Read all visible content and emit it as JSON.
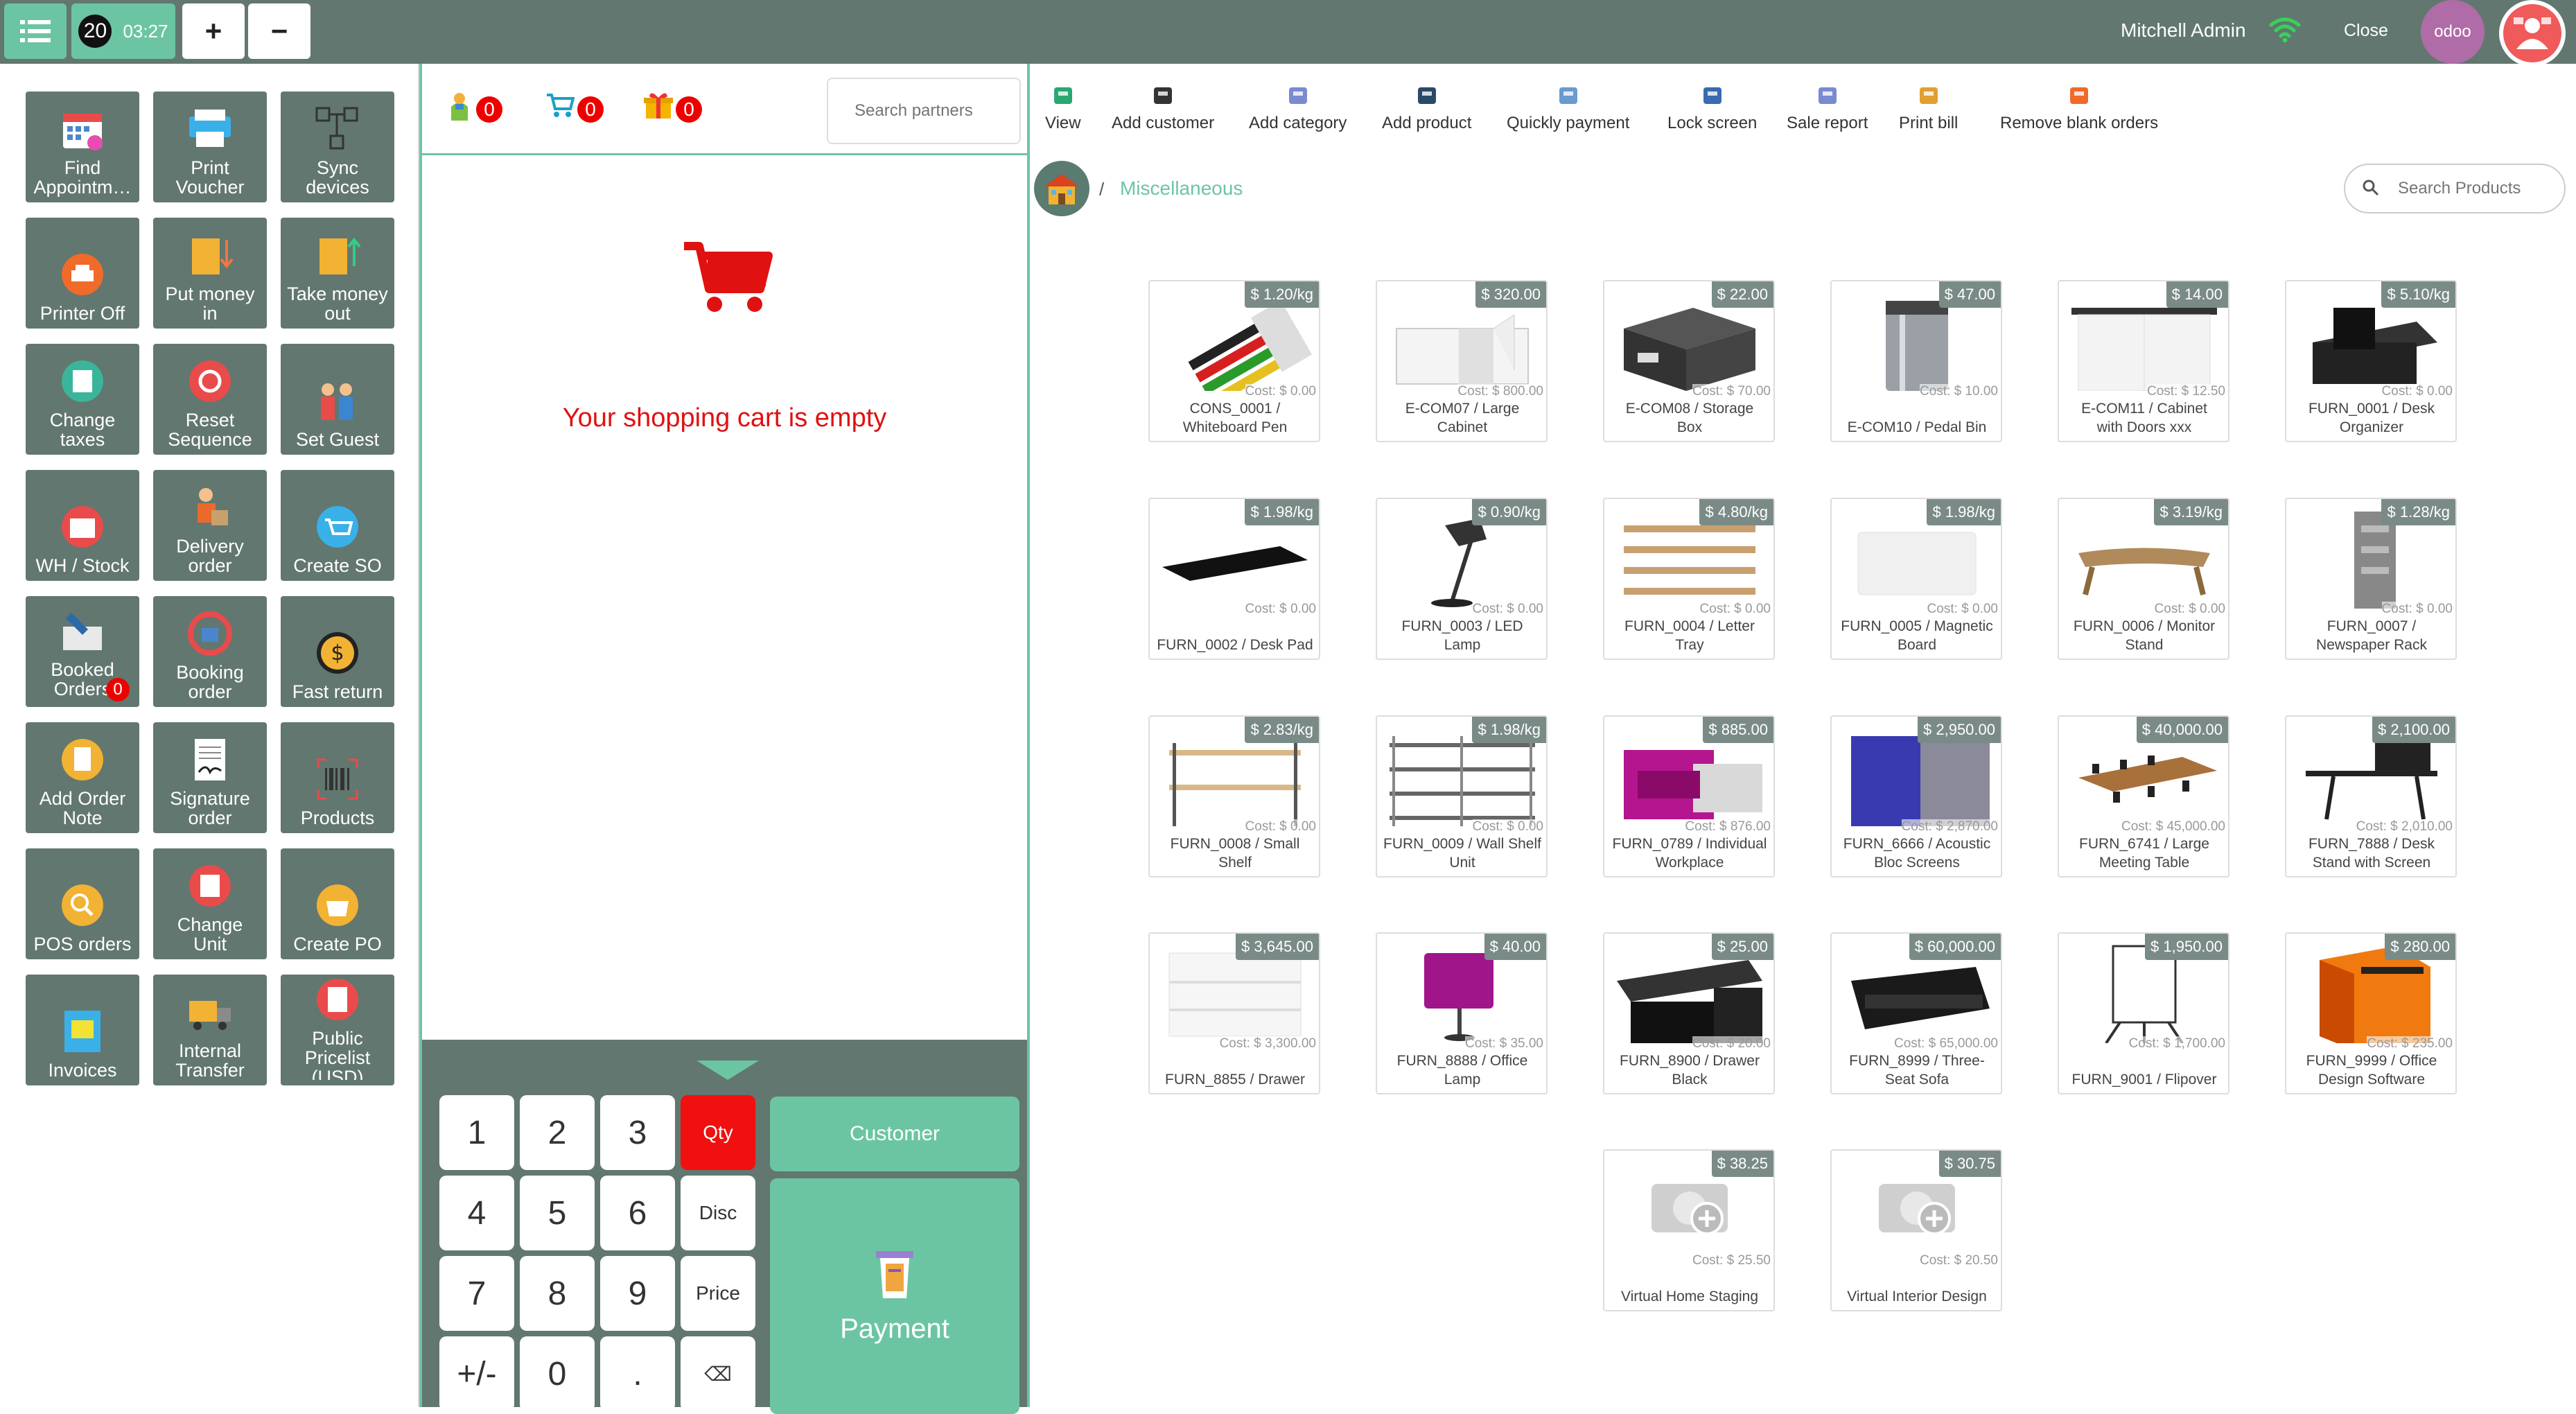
{
  "topbar": {
    "order_number": "20",
    "order_time": "03:27",
    "plus_label": "+",
    "minus_label": "−",
    "user_name": "Mitchell Admin",
    "close_label": "Close",
    "odoo_label": "odoo"
  },
  "tiles": [
    {
      "label": "Find\nAppointm…",
      "name": "find-appointment"
    },
    {
      "label": "Print\nVoucher",
      "name": "print-voucher"
    },
    {
      "label": "Sync\ndevices",
      "name": "sync-devices"
    },
    {
      "label": "Printer Off",
      "name": "printer-off"
    },
    {
      "label": "Put money\nin",
      "name": "put-money-in"
    },
    {
      "label": "Take money\nout",
      "name": "take-money-out"
    },
    {
      "label": "Change\ntaxes",
      "name": "change-taxes"
    },
    {
      "label": "Reset\nSequence",
      "name": "reset-sequence"
    },
    {
      "label": "Set Guest",
      "name": "set-guest"
    },
    {
      "label": "WH / Stock",
      "name": "wh-stock"
    },
    {
      "label": "Delivery\norder",
      "name": "delivery-order"
    },
    {
      "label": "Create SO",
      "name": "create-so"
    },
    {
      "label": "Booked\nOrders",
      "name": "booked-orders",
      "badge": "0"
    },
    {
      "label": "Booking\norder",
      "name": "booking-order"
    },
    {
      "label": "Fast return",
      "name": "fast-return"
    },
    {
      "label": "Add Order\nNote",
      "name": "add-order-note"
    },
    {
      "label": "Signature\norder",
      "name": "signature-order"
    },
    {
      "label": "Products",
      "name": "products"
    },
    {
      "label": "POS orders",
      "name": "pos-orders"
    },
    {
      "label": "Change\nUnit",
      "name": "change-unit"
    },
    {
      "label": "Create PO",
      "name": "create-po"
    },
    {
      "label": "Invoices",
      "name": "invoices"
    },
    {
      "label": "Internal\nTransfer",
      "name": "internal-transfer"
    },
    {
      "label": "Public\nPricelist\n(USD)",
      "name": "public-pricelist"
    }
  ],
  "order_header": {
    "client_count": "0",
    "cart_count": "0",
    "gift_count": "0",
    "search_placeholder": "Search partners"
  },
  "cart": {
    "empty_message": "Your shopping cart is empty"
  },
  "numpad": {
    "keys": [
      "1",
      "2",
      "3",
      "Qty",
      "4",
      "5",
      "6",
      "Disc",
      "7",
      "8",
      "9",
      "Price",
      "+/-",
      "0",
      ".",
      "⌫"
    ],
    "customer_label": "Customer",
    "payment_label": "Payment"
  },
  "toolbar": [
    {
      "label": "View",
      "icon": "view-icon"
    },
    {
      "label": "Add customer",
      "icon": "add-customer-icon"
    },
    {
      "label": "Add category",
      "icon": "add-category-icon"
    },
    {
      "label": "Add product",
      "icon": "add-product-icon"
    },
    {
      "label": "Quickly payment",
      "icon": "quick-payment-icon"
    },
    {
      "label": "Lock screen",
      "icon": "lock-screen-icon"
    },
    {
      "label": "Sale report",
      "icon": "sale-report-icon"
    },
    {
      "label": "Print bill",
      "icon": "print-bill-icon"
    },
    {
      "label": "Remove blank orders",
      "icon": "trash-icon"
    }
  ],
  "breadcrumb": {
    "separator": "/",
    "category": "Miscellaneous"
  },
  "search_products_placeholder": "Search Products",
  "products": [
    {
      "name": "CONS_0001 /\nWhiteboard Pen",
      "price": "$ 1.20/kg",
      "cost": "Cost: $ 0.00",
      "kind": "pens"
    },
    {
      "name": "E-COM07 / Large\nCabinet",
      "price": "$ 320.00",
      "cost": "Cost: $ 800.00",
      "kind": "cabinet"
    },
    {
      "name": "E-COM08 / Storage\nBox",
      "price": "$ 22.00",
      "cost": "Cost: $ 70.00",
      "kind": "box"
    },
    {
      "name": "E-COM10 / Pedal Bin",
      "price": "$ 47.00",
      "cost": "Cost: $ 10.00",
      "kind": "bin"
    },
    {
      "name": "E-COM11 / Cabinet\nwith Doors xxx",
      "price": "$ 14.00",
      "cost": "Cost: $ 12.50",
      "kind": "cabinet2"
    },
    {
      "name": "FURN_0001 / Desk\nOrganizer",
      "price": "$ 5.10/kg",
      "cost": "Cost: $ 0.00",
      "kind": "organizer"
    },
    {
      "name": "FURN_0002 / Desk Pad",
      "price": "$ 1.98/kg",
      "cost": "Cost: $ 0.00",
      "kind": "pad"
    },
    {
      "name": "FURN_0003 / LED\nLamp",
      "price": "$ 0.90/kg",
      "cost": "Cost: $ 0.00",
      "kind": "lamp"
    },
    {
      "name": "FURN_0004 / Letter\nTray",
      "price": "$ 4.80/kg",
      "cost": "Cost: $ 0.00",
      "kind": "tray"
    },
    {
      "name": "FURN_0005 / Magnetic\nBoard",
      "price": "$ 1.98/kg",
      "cost": "Cost: $ 0.00",
      "kind": "board"
    },
    {
      "name": "FURN_0006 / Monitor\nStand",
      "price": "$ 3.19/kg",
      "cost": "Cost: $ 0.00",
      "kind": "stand"
    },
    {
      "name": "FURN_0007 /\nNewspaper Rack",
      "price": "$ 1.28/kg",
      "cost": "Cost: $ 0.00",
      "kind": "rack"
    },
    {
      "name": "FURN_0008 / Small\nShelf",
      "price": "$ 2.83/kg",
      "cost": "Cost: $ 0.00",
      "kind": "shelf"
    },
    {
      "name": "FURN_0009 / Wall Shelf\nUnit",
      "price": "$ 1.98/kg",
      "cost": "Cost: $ 0.00",
      "kind": "wallshelf"
    },
    {
      "name": "FURN_0789 / Individual\nWorkplace",
      "price": "$ 885.00",
      "cost": "Cost: $ 876.00",
      "kind": "workplace"
    },
    {
      "name": "FURN_6666 / Acoustic\nBloc Screens",
      "price": "$ 2,950.00",
      "cost": "Cost: $ 2,870.00",
      "kind": "screens"
    },
    {
      "name": "FURN_6741 / Large\nMeeting Table",
      "price": "$ 40,000.00",
      "cost": "Cost: $ 45,000.00",
      "kind": "table"
    },
    {
      "name": "FURN_7888 / Desk\nStand with Screen",
      "price": "$ 2,100.00",
      "cost": "Cost: $ 2,010.00",
      "kind": "desk"
    },
    {
      "name": "FURN_8855 / Drawer",
      "price": "$ 3,645.00",
      "cost": "Cost: $ 3,300.00",
      "kind": "drawer"
    },
    {
      "name": "FURN_8888 / Office\nLamp",
      "price": "$ 40.00",
      "cost": "Cost: $ 35.00",
      "kind": "officelamp"
    },
    {
      "name": "FURN_8900 / Drawer\nBlack",
      "price": "$ 25.00",
      "cost": "Cost: $ 20.00",
      "kind": "drawerblack"
    },
    {
      "name": "FURN_8999 / Three-\nSeat Sofa",
      "price": "$ 60,000.00",
      "cost": "Cost: $ 65,000.00",
      "kind": "sofa"
    },
    {
      "name": "FURN_9001 / Flipover",
      "price": "$ 1,950.00",
      "cost": "Cost: $ 1,700.00",
      "kind": "flipover"
    },
    {
      "name": "FURN_9999 / Office\nDesign Software",
      "price": "$ 280.00",
      "cost": "Cost: $ 235.00",
      "kind": "software"
    },
    {
      "name": "Virtual Home Staging",
      "price": "$ 38.25",
      "cost": "Cost: $ 25.50",
      "kind": "placeholder"
    },
    {
      "name": "Virtual Interior Design",
      "price": "$ 30.75",
      "cost": "Cost: $ 20.50",
      "kind": "placeholder"
    }
  ],
  "colors": {
    "topbar": "#62776f",
    "accent": "#6cc5a2",
    "alert_red": "#e01111",
    "price_tag": "#7a8b87"
  }
}
